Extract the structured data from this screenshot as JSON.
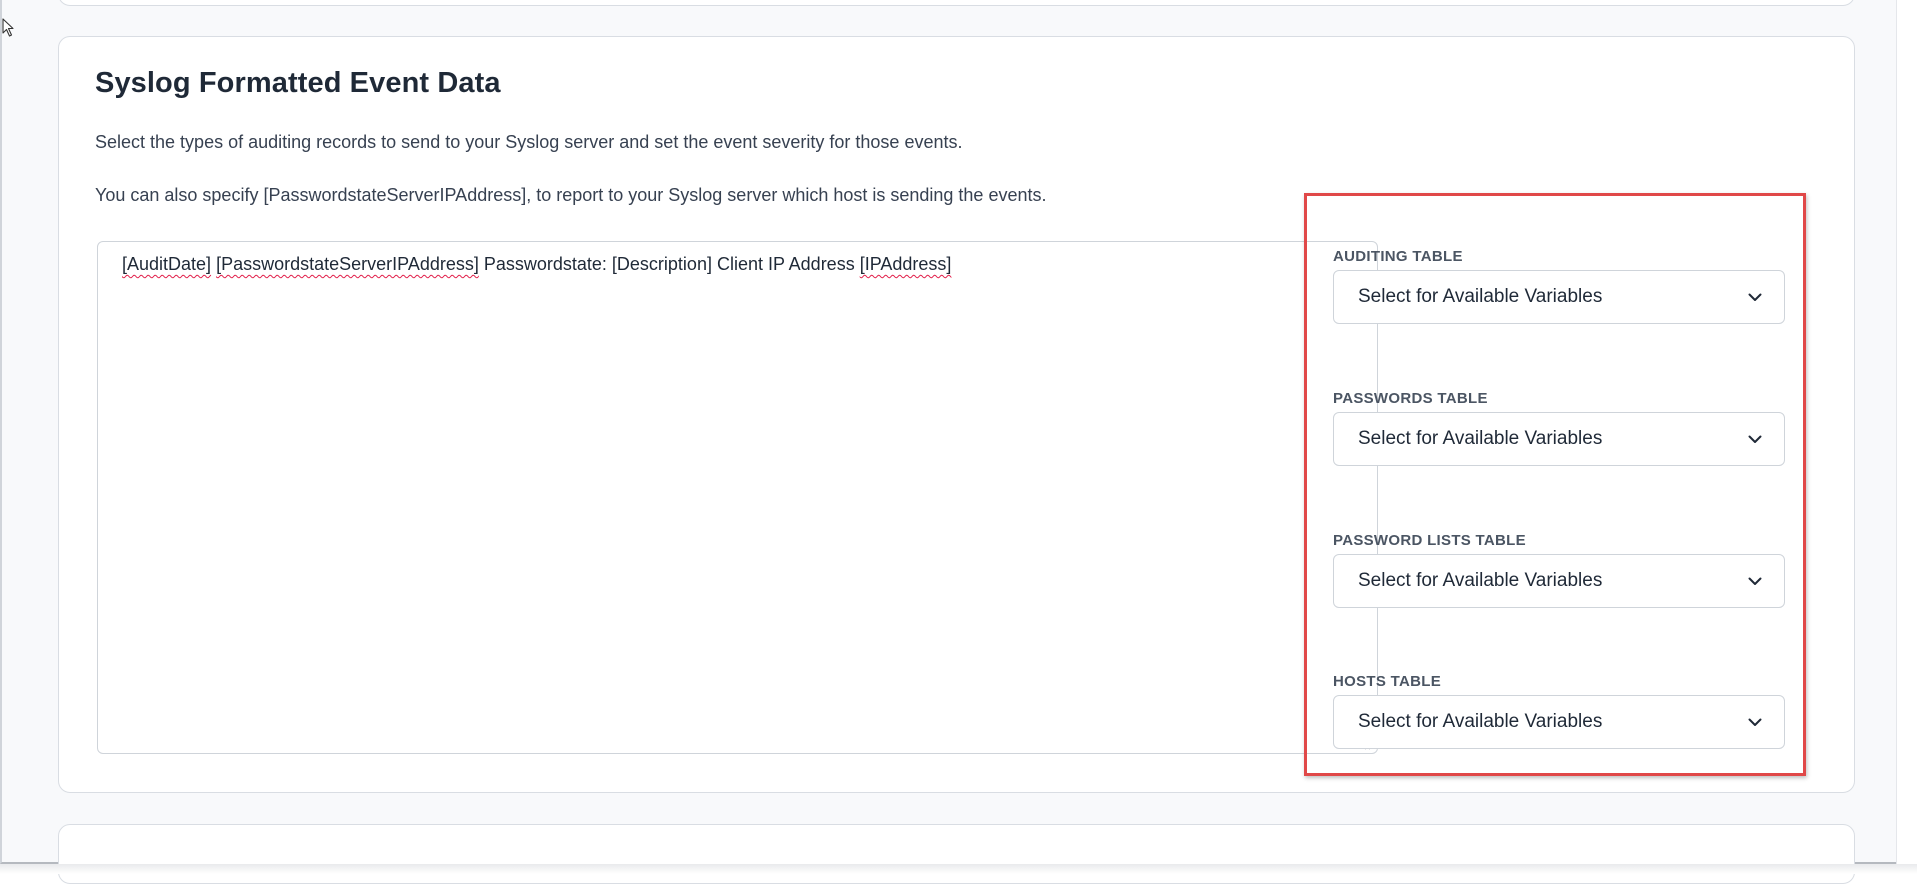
{
  "section": {
    "title": "Syslog Formatted Event Data",
    "description_1": "Select the types of auditing records to send to your Syslog server and set the event severity for those events.",
    "description_2": "You can also specify [PasswordstateServerIPAddress], to report to your Syslog server which host is sending the events."
  },
  "template": {
    "tokens": [
      {
        "text": "[AuditDate]",
        "misspelled": true
      },
      {
        "text": " ",
        "misspelled": false
      },
      {
        "text": "[PasswordstateServerIPAddress]",
        "misspelled": true
      },
      {
        "text": " Passwordstate: [Description] Client IP Address ",
        "misspelled": false
      },
      {
        "text": "[IPAddress]",
        "misspelled": true
      }
    ]
  },
  "variables": {
    "auditing": {
      "label": "AUDITING TABLE",
      "selected": "Select for Available Variables"
    },
    "passwords": {
      "label": "PASSWORDS TABLE",
      "selected": "Select for Available Variables"
    },
    "password_lists": {
      "label": "PASSWORD LISTS TABLE",
      "selected": "Select for Available Variables"
    },
    "hosts": {
      "label": "HOSTS TABLE",
      "selected": "Select for Available Variables"
    }
  },
  "colors": {
    "highlight": "#e04848",
    "spellcheck": "#e11d48",
    "border": "#d9dde3",
    "text": "#1f2937"
  },
  "icons": {
    "cursor": "mouse-pointer-icon",
    "chevron": "chevron-down-icon",
    "resize": "resize-handle-icon"
  }
}
